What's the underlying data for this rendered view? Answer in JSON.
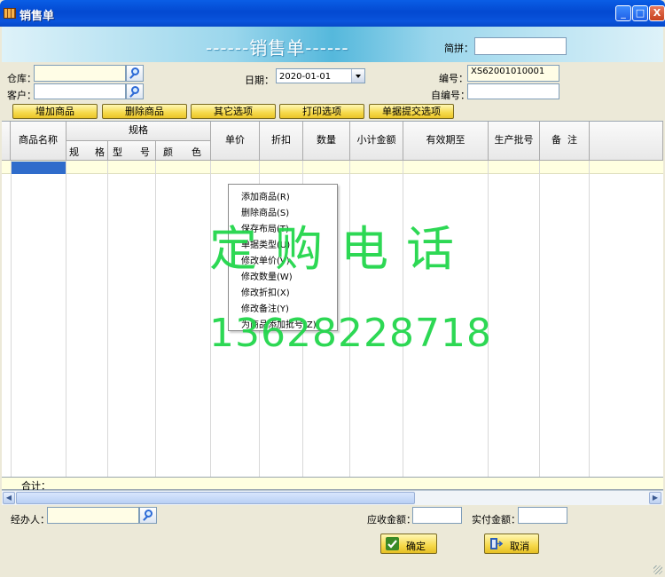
{
  "window": {
    "title": "销售单",
    "minimize": "_",
    "maximize": "□",
    "close": "X"
  },
  "banner": {
    "title": "------销售单------",
    "jianpin_label": "简拼：",
    "jianpin_value": ""
  },
  "form": {
    "warehouse_label": "仓库：",
    "warehouse_value": "",
    "customer_label": "客户：",
    "customer_value": "",
    "date_label": "日期：",
    "date_value": "2020-01-01",
    "number_label": "编号：",
    "number_value": "XS62001010001",
    "self_number_label": "自编号：",
    "self_number_value": ""
  },
  "toolbar": [
    "增加商品",
    "删除商品",
    "其它选项",
    "打印选项",
    "单据提交选项"
  ],
  "grid": {
    "headers": {
      "name": "商品名称",
      "spec": "规格",
      "sub_spec_a": "规",
      "sub_spec_b": "格",
      "sub_model_a": "型",
      "sub_model_b": "号",
      "sub_color_a": "颜",
      "sub_color_b": "色",
      "price": "单价",
      "discount": "折扣",
      "qty": "数量",
      "subtotal": "小计金额",
      "expiry": "有效期至",
      "batch": "生产批号",
      "remark": "备  注"
    },
    "sum_label": "合计："
  },
  "context_menu": [
    "添加商品(R)",
    "删除商品(S)",
    "保存布局(T)",
    "单据类型(U)",
    "修改单价(V)",
    "修改数量(W)",
    "修改折扣(X)",
    "修改备注(Y)",
    "为商品添加批号(Z)"
  ],
  "footer": {
    "handler_label": "经办人：",
    "handler_value": "",
    "receivable_label": "应收金额：",
    "receivable_value": "",
    "paid_label": "实付金额：",
    "paid_value": "",
    "ok": "确定",
    "cancel": "取消"
  },
  "watermark": {
    "line1": "定购电话",
    "line2": "13628228718"
  },
  "colors": {
    "titlebar": "#0a54dc",
    "banner": "#55b8dc",
    "button": "#f6d94a",
    "watermark": "#22d64b",
    "selection": "#2f6ccb"
  }
}
